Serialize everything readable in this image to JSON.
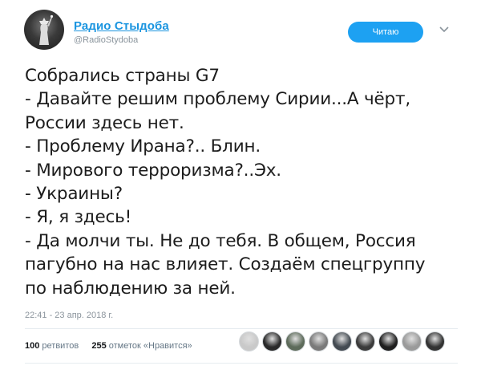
{
  "account": {
    "display_name": "Радио Стыдоба",
    "handle": "@RadioStydoba"
  },
  "follow_button_label": "Читаю",
  "tweet": {
    "lines": [
      "Собрались страны G7",
      "- Давайте решим проблему Сирии...А чёрт,",
      "России здесь нет.",
      "- Проблему Ирана?.. Блин.",
      "- Мирового терроризма?..Эх.",
      "- Украины?",
      "- Я, я здесь!",
      "- Да молчи ты. Не до тебя. В общем, Россия",
      "пагубно на нас влияет. Создаём спецгруппу",
      "по наблюдению за ней."
    ],
    "timestamp": "22:41 - 23 апр. 2018 г."
  },
  "stats": {
    "retweets_count": "100",
    "retweets_label": "ретвитов",
    "likes_count": "255",
    "likes_label": "отметок «Нравится»"
  },
  "likers": [
    {
      "name": "liker-1-avatar",
      "color": "#c9c9c9"
    },
    {
      "name": "liker-2-avatar",
      "color": "#2a2a2a"
    },
    {
      "name": "liker-3-avatar",
      "color": "#5d6b5a"
    },
    {
      "name": "liker-4-avatar",
      "color": "#7a7a7a"
    },
    {
      "name": "liker-5-avatar",
      "color": "#444b52"
    },
    {
      "name": "liker-6-avatar",
      "color": "#3b3b3b"
    },
    {
      "name": "liker-7-avatar",
      "color": "#1f1f1f"
    },
    {
      "name": "liker-8-avatar",
      "color": "#9a9a9a"
    },
    {
      "name": "liker-9-avatar",
      "color": "#333333"
    }
  ],
  "colors": {
    "accent": "#1da1f2",
    "name_link": "#1b95e0",
    "muted_text": "#8a949c",
    "divider": "#e6ecf0"
  }
}
